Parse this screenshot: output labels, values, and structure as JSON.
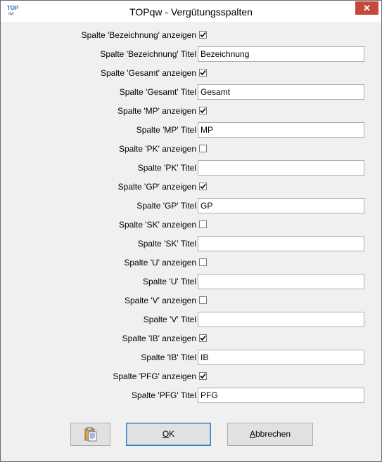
{
  "window": {
    "title": "TOPqw - Vergütungsspalten",
    "app_icon_text": "TOP",
    "app_icon_sub": "qw",
    "close_glyph": "✕"
  },
  "fields": [
    {
      "checkbox_label": "Spalte 'Bezeichnung' anzeigen",
      "checked": true,
      "title_label": "Spalte 'Bezeichnung' Titel",
      "title_value": "Bezeichnung"
    },
    {
      "checkbox_label": "Spalte 'Gesamt' anzeigen",
      "checked": true,
      "title_label": "Spalte 'Gesamt' Titel",
      "title_value": "Gesamt"
    },
    {
      "checkbox_label": "Spalte 'MP' anzeigen",
      "checked": true,
      "title_label": "Spalte 'MP' Titel",
      "title_value": "MP"
    },
    {
      "checkbox_label": "Spalte 'PK' anzeigen",
      "checked": false,
      "title_label": "Spalte 'PK' Titel",
      "title_value": ""
    },
    {
      "checkbox_label": "Spalte 'GP' anzeigen",
      "checked": true,
      "title_label": "Spalte 'GP' Titel",
      "title_value": "GP"
    },
    {
      "checkbox_label": "Spalte 'SK' anzeigen",
      "checked": false,
      "title_label": "Spalte 'SK' Titel",
      "title_value": ""
    },
    {
      "checkbox_label": "Spalte 'U' anzeigen",
      "checked": false,
      "title_label": "Spalte 'U' Titel",
      "title_value": ""
    },
    {
      "checkbox_label": "Spalte 'V' anzeigen",
      "checked": false,
      "title_label": "Spalte 'V' Titel",
      "title_value": ""
    },
    {
      "checkbox_label": "Spalte 'IB' anzeigen",
      "checked": true,
      "title_label": "Spalte 'IB' Titel",
      "title_value": "IB"
    },
    {
      "checkbox_label": "Spalte 'PFG' anzeigen",
      "checked": true,
      "title_label": "Spalte 'PFG' Titel",
      "title_value": "PFG"
    }
  ],
  "buttons": {
    "clipboard_icon": "clipboard-icon",
    "ok_accel": "O",
    "ok_rest": "K",
    "cancel_accel": "A",
    "cancel_rest": "bbrechen"
  }
}
